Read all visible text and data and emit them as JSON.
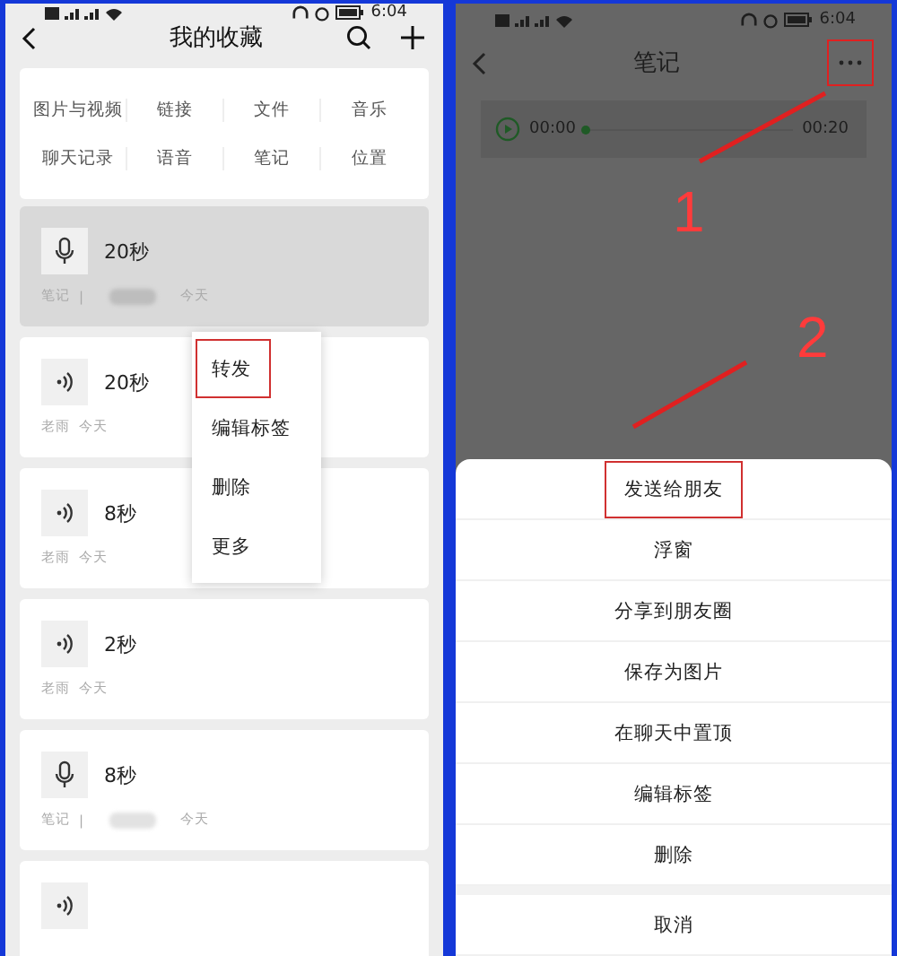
{
  "left": {
    "status_bar": {
      "time": "6:04"
    },
    "header": {
      "title": "我的收藏"
    },
    "categories": [
      {
        "label": "图片与视频"
      },
      {
        "label": "链接"
      },
      {
        "label": "文件"
      },
      {
        "label": "音乐"
      },
      {
        "label": "聊天记录"
      },
      {
        "label": "语音"
      },
      {
        "label": "笔记"
      },
      {
        "label": "位置"
      }
    ],
    "items": [
      {
        "kind": "mic",
        "duration": "20秒",
        "source": "笔记",
        "separator": "|",
        "blurred": true,
        "date": "今天",
        "selected": true
      },
      {
        "kind": "voice",
        "duration": "20秒",
        "source": "老雨",
        "date": "今天",
        "selected": false
      },
      {
        "kind": "voice",
        "duration": "8秒",
        "source": "老雨",
        "date": "今天",
        "selected": false
      },
      {
        "kind": "voice",
        "duration": "2秒",
        "source": "老雨",
        "date": "今天",
        "selected": false
      },
      {
        "kind": "mic",
        "duration": "8秒",
        "source": "笔记",
        "separator": "|",
        "blurred": true,
        "date": "今天",
        "selected": false
      },
      {
        "kind": "voice",
        "selected": false
      }
    ],
    "context_menu": [
      {
        "label": "转发",
        "annotated": true
      },
      {
        "label": "编辑标签",
        "annotated": false
      },
      {
        "label": "删除",
        "annotated": false
      },
      {
        "label": "更多",
        "annotated": false
      }
    ]
  },
  "right": {
    "status_bar": {
      "time": "6:04"
    },
    "header": {
      "title": "笔记",
      "more_annotated": true
    },
    "player": {
      "elapsed": "00:00",
      "total": "00:20",
      "level": 0
    },
    "annotations": [
      {
        "label": "1"
      },
      {
        "label": "2"
      }
    ],
    "sheet": [
      {
        "label": "发送给朋友",
        "kind": "action",
        "annotated": true
      },
      {
        "label": "浮窗",
        "kind": "action",
        "annotated": false
      },
      {
        "label": "分享到朋友圈",
        "kind": "action",
        "annotated": false
      },
      {
        "label": "保存为图片",
        "kind": "action",
        "annotated": false
      },
      {
        "label": "在聊天中置顶",
        "kind": "action",
        "annotated": false
      },
      {
        "label": "编辑标签",
        "kind": "action",
        "annotated": false
      },
      {
        "label": "删除",
        "kind": "action",
        "annotated": false
      },
      {
        "label": "取消",
        "kind": "cancel",
        "annotated": false
      }
    ]
  }
}
